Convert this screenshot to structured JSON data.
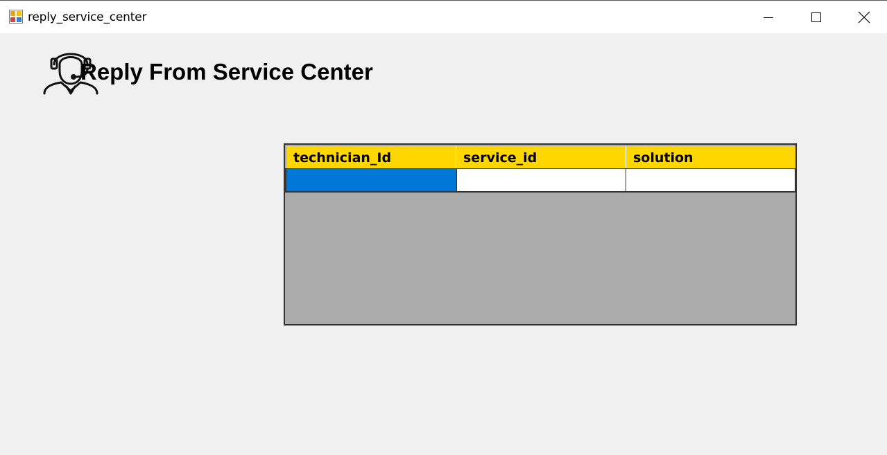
{
  "window": {
    "title": "reply_service_center",
    "app_icon": "winforms-app-icon",
    "controls": [
      "minimize-icon",
      "maximize-icon",
      "close-icon"
    ]
  },
  "header": {
    "icon": "customer-support-agent-icon",
    "title": "Reply From Service Center"
  },
  "grid": {
    "columns": [
      "technician_Id",
      "service_id",
      "solution"
    ],
    "rows": [
      [
        "",
        "",
        ""
      ]
    ],
    "header_color": "#ffd700",
    "selected_color": "#0078d7",
    "background_color": "#ababab"
  }
}
